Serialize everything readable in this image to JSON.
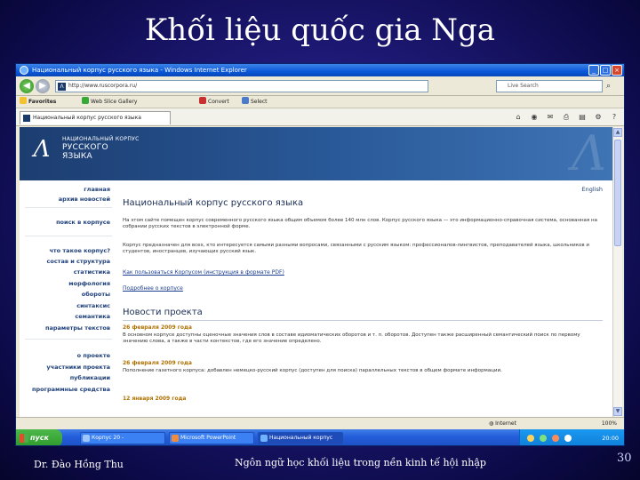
{
  "slide": {
    "title": "Khối liệu quốc gia Nga",
    "footer_author": "Dr. Đào Hồng Thu",
    "footer_topic": "Ngôn ngữ học khối liệu trong nền kinh tế hội nhập",
    "page_number": "30"
  },
  "browser": {
    "window_title": "Национальный корпус русского языка - Windows Internet Explorer",
    "address": "http://www.ruscorpora.ru/",
    "search_placeholder": "Live Search",
    "links": [
      "Favorites",
      "Web Slice Gallery",
      "Convert",
      "Select"
    ],
    "tab_title": "Национальный корпус русского языка",
    "status_zone": "Internet",
    "zoom": "100%"
  },
  "site": {
    "logo_line1": "НАЦИОНАЛЬНЫЙ КОРПУС",
    "logo_line2": "РУССКОГО",
    "logo_line3": "ЯЗЫКА",
    "lang_link": "English",
    "sidebar": [
      "главная",
      "архив новостей",
      "поиск в корпусе",
      "что такое корпус?",
      "состав и структура",
      "статистика",
      "морфология",
      "обороты",
      "синтаксис",
      "семантика",
      "параметры текстов",
      "о проекте",
      "участники проекта",
      "публикации",
      "программные средства"
    ],
    "main_title": "Национальный корпус русского языка",
    "intro": "На этом сайте помещен корпус современного русского языка общим объемом более 140 млн слов. Корпус русского языка — это информационно-справочная система, основанная на собрании русских текстов в электронной форме.",
    "purpose": "Корпус предназначен для всех, кто интересуется самыми разными вопросами, связанными с русским языком: профессионалов-лингвистов, преподавателей языка, школьников и студентов, иностранцев, изучающих русский язык.",
    "link_howto": "Как пользоваться Корпусом (инструкция в формате PDF)",
    "link_more": "Подробнее о корпусе",
    "news_title": "Новости проекта",
    "news": [
      {
        "date": "26 февраля 2009 года",
        "text": "В основном корпусе доступны оценочные значения слов в составе идиоматических оборотов и т. п. оборотов. Доступен также расширенный семантический поиск по первому значению слова, а также в части контекстов, где его значение определено."
      },
      {
        "date": "26 февраля 2009 года",
        "text": "Пополнение газетного корпуса: добавлен немецко-русский корпус (доступен для поиска) параллельных текстов в общем формате информации."
      },
      {
        "date": "12 января 2009 года",
        "text": ""
      }
    ]
  },
  "taskbar": {
    "start_label": "пуск",
    "tasks": [
      "Корпус 20 -",
      "Microsoft PowerPoint",
      "Национальный корпус"
    ],
    "clock": "20:00"
  }
}
